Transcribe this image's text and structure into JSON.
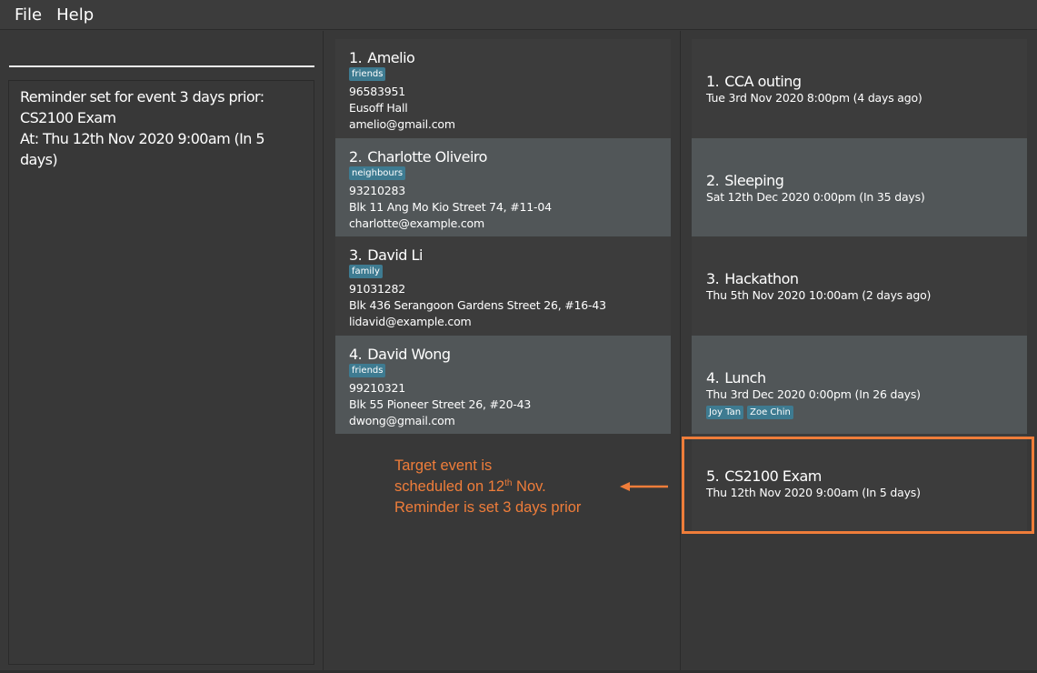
{
  "menu": {
    "file": "File",
    "help": "Help"
  },
  "command": {
    "value": "",
    "placeholder": ""
  },
  "result": {
    "text": "Reminder set for event 3 days prior:\nCS2100 Exam\nAt: Thu 12th Nov 2020 9:00am (In 5\ndays)"
  },
  "persons": [
    {
      "index": "1.",
      "name": "Amelio",
      "tags": [
        "friends"
      ],
      "phone": "96583951",
      "address": "Eusoff Hall",
      "email": "amelio@gmail.com"
    },
    {
      "index": "2.",
      "name": "Charlotte Oliveiro",
      "tags": [
        "neighbours"
      ],
      "phone": "93210283",
      "address": "Blk 11 Ang Mo Kio Street 74, #11-04",
      "email": "charlotte@example.com"
    },
    {
      "index": "3.",
      "name": "David Li",
      "tags": [
        "family"
      ],
      "phone": "91031282",
      "address": "Blk 436 Serangoon Gardens Street 26, #16-43",
      "email": "lidavid@example.com"
    },
    {
      "index": "4.",
      "name": "David Wong",
      "tags": [
        "friends"
      ],
      "phone": "99210321",
      "address": "Blk 55 Pioneer Street 26, #20-43",
      "email": "dwong@gmail.com"
    }
  ],
  "events": [
    {
      "index": "1.",
      "name": "CCA outing",
      "time": "Tue 3rd Nov 2020 8:00pm (4 days ago)",
      "tags": []
    },
    {
      "index": "2.",
      "name": "Sleeping",
      "time": "Sat 12th Dec 2020 0:00pm (In 35 days)",
      "tags": []
    },
    {
      "index": "3.",
      "name": "Hackathon",
      "time": "Thu 5th Nov 2020 10:00am (2 days ago)",
      "tags": []
    },
    {
      "index": "4.",
      "name": "Lunch",
      "time": "Thu 3rd Dec 2020 0:00pm (In 26 days)",
      "tags": [
        "Joy Tan",
        "Zoe Chin"
      ]
    },
    {
      "index": "5.",
      "name": "CS2100 Exam",
      "time": "Thu 12th Nov 2020 9:00am (In 5 days)",
      "tags": []
    }
  ],
  "annotation": {
    "line1": "Target event is",
    "line2_pre": "scheduled on 12",
    "line2_sup": "th",
    "line2_post": " Nov.",
    "line3": "Reminder is set 3 days prior"
  },
  "colors": {
    "annotation": "#ef7d3a",
    "tag": "#3e7b91",
    "card_dark": "#3c3c3c",
    "card_light": "#515658",
    "background": "#383838"
  },
  "icons": {
    "arrow": "arrow-left-icon"
  }
}
